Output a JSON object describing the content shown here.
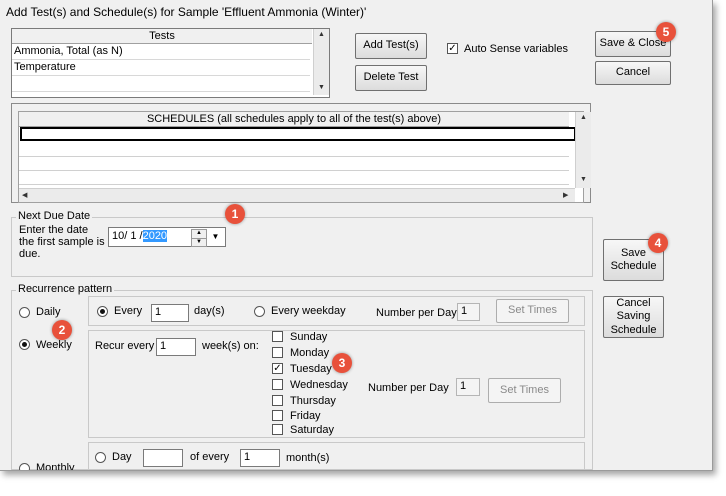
{
  "window": {
    "title": "Add Test(s) and Schedule(s) for Sample 'Effluent Ammonia (Winter)'"
  },
  "tests": {
    "header": "Tests",
    "rows": [
      "Ammonia, Total (as N)",
      "Temperature"
    ]
  },
  "buttons": {
    "add_test": "Add Test(s)",
    "delete_test": "Delete Test",
    "save_close": "Save & Close",
    "cancel": "Cancel",
    "save_schedule": "Save Schedule",
    "cancel_saving_schedule": "Cancel Saving Schedule",
    "set_times": "Set Times"
  },
  "auto_sense": {
    "label": "Auto Sense variables",
    "checked": true
  },
  "schedules": {
    "header": "SCHEDULES (all schedules apply to all of the test(s) above)"
  },
  "next_due": {
    "legend": "Next Due Date",
    "prompt": "Enter the date the first sample is due.",
    "date_prefix": "10/ 1 /",
    "year": "2020"
  },
  "recurrence": {
    "legend": "Recurrence pattern",
    "daily": "Daily",
    "weekly": "Weekly",
    "monthly": "Monthly",
    "selected": "Weekly"
  },
  "daily_opts": {
    "every": "Every",
    "every_value": "1",
    "days_label": "day(s)",
    "every_weekday": "Every weekday",
    "number_per_day": "Number per Day",
    "number_per_day_value": "1"
  },
  "weekly_opts": {
    "recur_every": "Recur every",
    "recur_value": "1",
    "weeks_on": "week(s) on:",
    "days": [
      {
        "name": "Sunday",
        "checked": false
      },
      {
        "name": "Monday",
        "checked": false
      },
      {
        "name": "Tuesday",
        "checked": true
      },
      {
        "name": "Wednesday",
        "checked": false
      },
      {
        "name": "Thursday",
        "checked": false
      },
      {
        "name": "Friday",
        "checked": false
      },
      {
        "name": "Saturday",
        "checked": false
      }
    ],
    "number_per_day": "Number per Day",
    "number_per_day_value": "1"
  },
  "monthly_opts": {
    "day": "Day",
    "day_value": "",
    "of_every": "of every",
    "of_every_value": "1",
    "months": "month(s)"
  },
  "callouts": [
    "1",
    "2",
    "3",
    "4",
    "5"
  ],
  "colors": {
    "callout": "#e8513b",
    "selection": "#3399ff"
  }
}
